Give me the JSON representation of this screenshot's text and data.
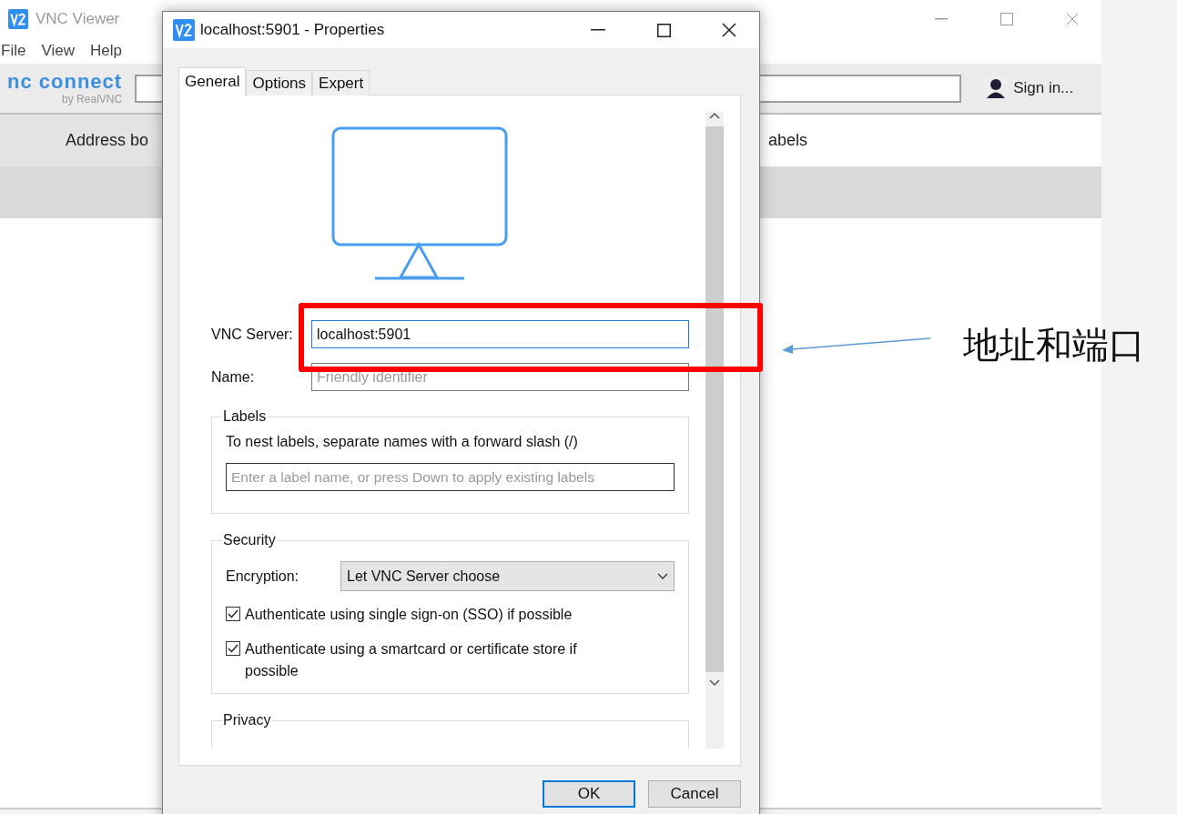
{
  "background_window": {
    "title": "VNC Viewer",
    "menu": [
      "File",
      "View",
      "Help"
    ],
    "logo": {
      "wordmark": "nc connect",
      "byline": "by RealVNC"
    },
    "sign_in": "Sign in...",
    "tabs": [
      {
        "label": "Address bo",
        "selected": true
      },
      {
        "label": "abels",
        "selected": false
      }
    ]
  },
  "dialog": {
    "title": "localhost:5901 - Properties",
    "tabs": [
      {
        "label": "General",
        "selected": true
      },
      {
        "label": "Options",
        "selected": false
      },
      {
        "label": "Expert",
        "selected": false
      }
    ],
    "server": {
      "label": "VNC Server:",
      "value": "localhost:5901",
      "focused": true
    },
    "name": {
      "label": "Name:",
      "placeholder": "Friendly identifier"
    },
    "labels_group": {
      "title": "Labels",
      "hint": "To nest labels, separate names with a forward slash (/)",
      "placeholder": "Enter a label name, or press Down to apply existing labels"
    },
    "security_group": {
      "title": "Security",
      "encryption_label": "Encryption:",
      "encryption_value": "Let VNC Server choose",
      "checkboxes": [
        {
          "label": "Authenticate using single sign-on (SSO) if possible",
          "checked": true
        },
        {
          "label": "Authenticate using a smartcard or certificate store if possible",
          "checked": true
        }
      ]
    },
    "privacy_group": {
      "title": "Privacy"
    },
    "buttons": [
      {
        "label": "OK",
        "default": true
      },
      {
        "label": "Cancel",
        "default": false
      }
    ]
  },
  "annotation": {
    "text": "地址和端口"
  }
}
